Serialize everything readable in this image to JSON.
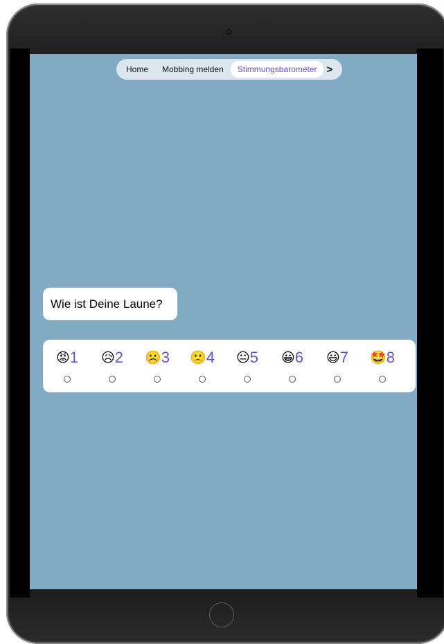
{
  "tabs": [
    {
      "label": "Home",
      "active": false
    },
    {
      "label": "Mobbing melden",
      "active": false
    },
    {
      "label": "Stimmungsbarometer",
      "active": true
    }
  ],
  "tab_next_icon": "chevron-right-icon",
  "question": "Wie ist Deine Laune?",
  "rating": {
    "options": [
      {
        "emoji": "😡",
        "number": "1",
        "selected": false
      },
      {
        "emoji": "😥",
        "number": "2",
        "selected": false
      },
      {
        "emoji": "☹️",
        "number": "3",
        "selected": false
      },
      {
        "emoji": "🙁",
        "number": "4",
        "selected": false
      },
      {
        "emoji": "😐",
        "number": "5",
        "selected": false
      },
      {
        "emoji": "😀",
        "number": "6",
        "selected": false
      },
      {
        "emoji": "😃",
        "number": "7",
        "selected": false
      },
      {
        "emoji": "🤩",
        "number": "8",
        "selected": false
      }
    ]
  },
  "colors": {
    "screen_background": "#82aac5",
    "accent": "#5e55d6",
    "tab_bar": "#dbe6ee"
  }
}
